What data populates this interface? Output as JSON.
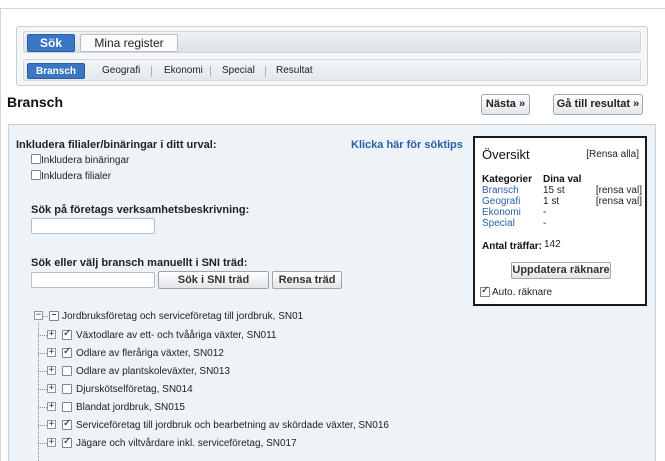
{
  "main_tabs": [
    {
      "label": "Sök",
      "active": true
    },
    {
      "label": "Mina register",
      "active": false
    }
  ],
  "sub_tabs": [
    {
      "label": "Bransch",
      "active": true
    },
    {
      "label": "Geografi",
      "active": false
    },
    {
      "label": "Ekonomi",
      "active": false
    },
    {
      "label": "Special",
      "active": false
    },
    {
      "label": "Resultat",
      "active": false
    }
  ],
  "page": {
    "title": "Bransch",
    "next_button": "Nästa »",
    "results_button": "Gå till resultat »"
  },
  "filters": {
    "heading": "Inkludera filialer/binäringar i ditt urval:",
    "tips_link": "Klicka här för söktips",
    "options": [
      {
        "label": "Inkludera binäringar",
        "checked": false
      },
      {
        "label": "Inkludera filialer",
        "checked": false
      }
    ]
  },
  "description_search": {
    "label": "Sök på företags verksamhetsbeskrivning:",
    "value": ""
  },
  "sni_search": {
    "label": "Sök eller välj bransch manuellt i SNI träd:",
    "value": "",
    "search_button": "Sök i SNI träd",
    "clear_button": "Rensa träd"
  },
  "summary": {
    "title": "Översikt",
    "clear_all": "[Rensa alla]",
    "col_category": "Kategorier",
    "col_selection": "Dina val",
    "rows": [
      {
        "category": "Bransch",
        "value": "15 st",
        "clear": "[rensa val]"
      },
      {
        "category": "Geografi",
        "value": "1 st",
        "clear": "[rensa val]"
      },
      {
        "category": "Ekonomi",
        "value": "-",
        "clear": ""
      },
      {
        "category": "Special",
        "value": "-",
        "clear": ""
      }
    ],
    "hits_label": "Antal träffar:",
    "hits_value": "142",
    "update_button": "Uppdatera räknare",
    "auto_counter_label": "Auto. räknare",
    "auto_counter_checked": true
  },
  "tree": {
    "root": {
      "label": "Jordbruksföretag och serviceföretag till jordbruk, SN01",
      "expander": "−",
      "checked": "partial"
    },
    "children": [
      {
        "label": "Växtodlare av ett- och tvååriga växter, SN011",
        "expander": "+",
        "checked": true
      },
      {
        "label": "Odlare av fleråriga växter, SN012",
        "expander": "+",
        "checked": true
      },
      {
        "label": "Odlare av plantskoleväxter, SN013",
        "expander": "+",
        "checked": false
      },
      {
        "label": "Djurskötselföretag, SN014",
        "expander": "+",
        "checked": false
      },
      {
        "label": "Blandat jordbruk, SN015",
        "expander": "+",
        "checked": false
      },
      {
        "label": "Serviceföretag till jordbruk och bearbetning av skördade växter, SN016",
        "expander": "+",
        "checked": true
      },
      {
        "label": "Jägare och viltvårdare inkl. serviceföretag, SN017",
        "expander": "+",
        "checked": true
      }
    ]
  }
}
